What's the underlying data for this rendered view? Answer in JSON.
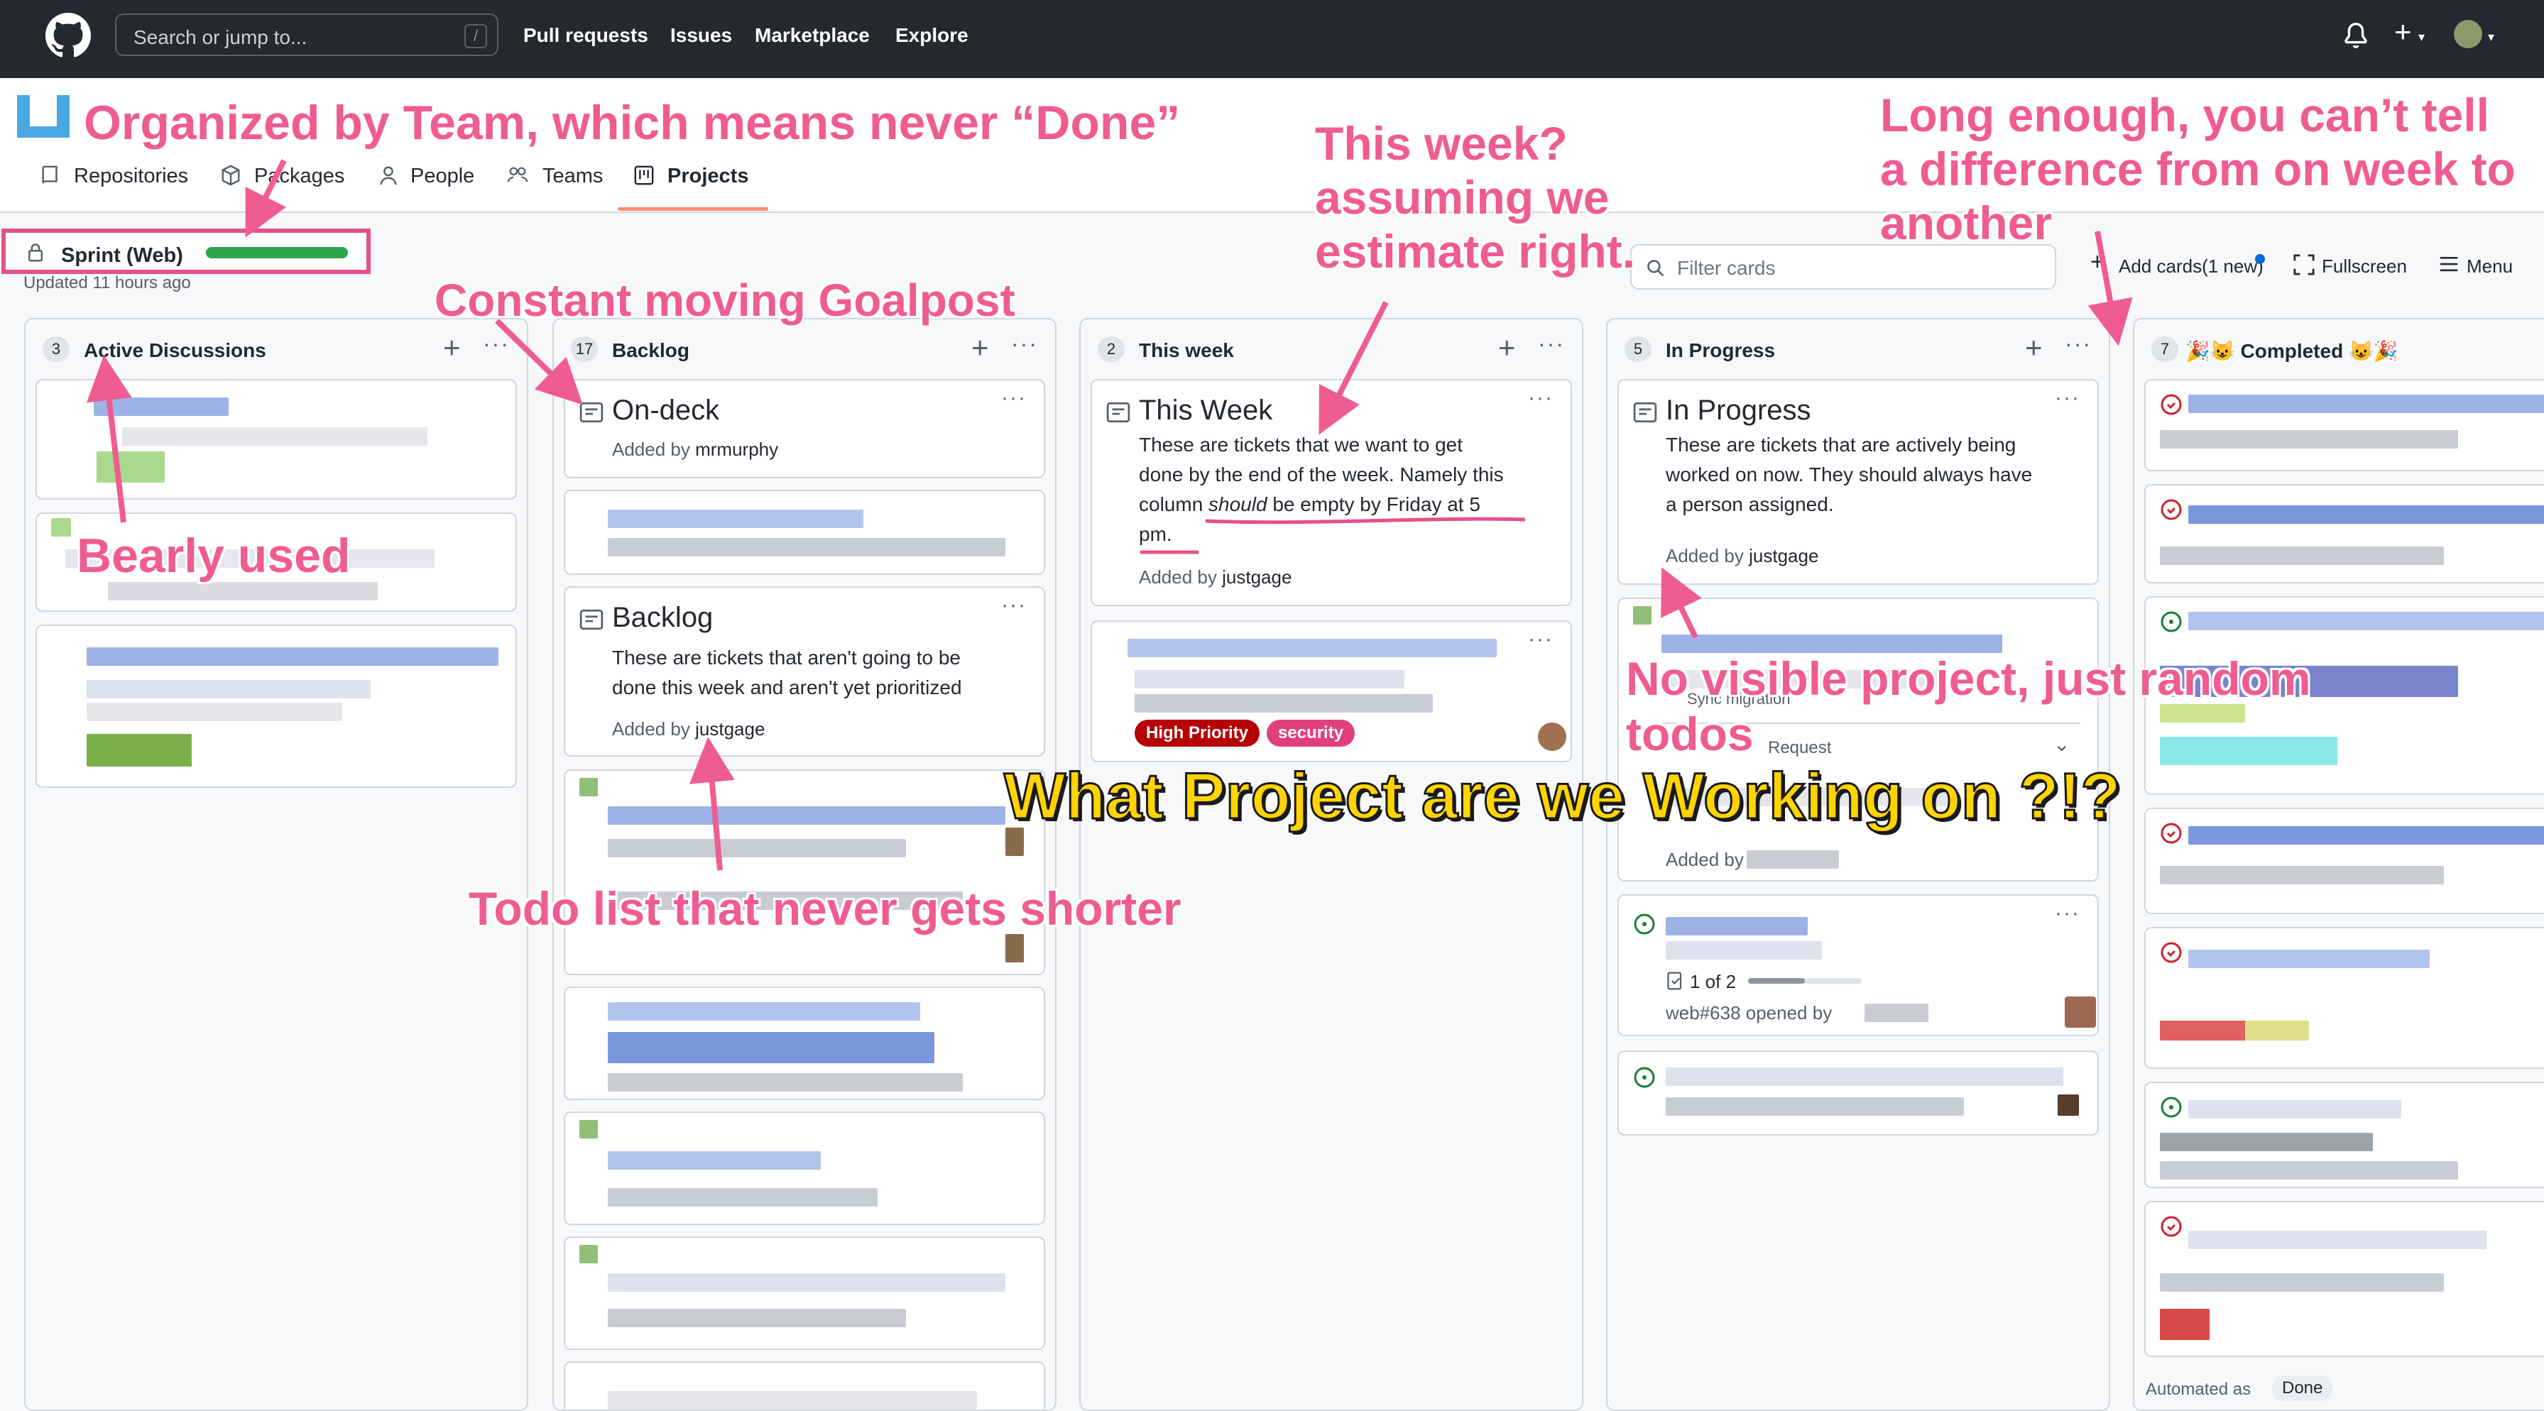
{
  "header": {
    "search_placeholder": "Search or jump to...",
    "search_key": "/",
    "nav": [
      "Pull requests",
      "Issues",
      "Marketplace",
      "Explore"
    ]
  },
  "org_tabs": [
    "Repositories",
    "Packages",
    "People",
    "Teams",
    "Projects"
  ],
  "project": {
    "name": "Sprint (Web)",
    "updated": "Updated 11 hours ago",
    "progress_percent": 100
  },
  "toolbar": {
    "filter_placeholder": "Filter cards",
    "add_cards": "Add cards(1 new)",
    "fullscreen": "Fullscreen",
    "menu": "Menu"
  },
  "columns": [
    {
      "count": "3",
      "title": "Active Discussions"
    },
    {
      "count": "17",
      "title": "Backlog"
    },
    {
      "count": "2",
      "title": "This week"
    },
    {
      "count": "5",
      "title": "In Progress"
    },
    {
      "count": "7",
      "title": "Completed",
      "emoji": "🎉😺 Completed 😺🎉"
    }
  ],
  "cards": {
    "ondeck": {
      "title": "On-deck",
      "added": "Added by",
      "user": "mrmurphy"
    },
    "backlog": {
      "title": "Backlog",
      "body": [
        "These are tickets that aren't going to be",
        "done this week and aren't yet prioritized"
      ],
      "added": "Added by",
      "user": "justgage"
    },
    "thisweek": {
      "title": "This Week",
      "body1": "These are tickets that we want to get",
      "body2": "done by the end of the week. Namely this",
      "body3a": "column ",
      "body3b": "should",
      "body3c": " be empty by Friday at 5",
      "body4": "pm.",
      "added": "Added by",
      "user": "justgage"
    },
    "labels": {
      "high": "High Priority",
      "security": "security"
    },
    "inprogress": {
      "title": "In Progress",
      "body": [
        "These are tickets that are actively being",
        "worked on now. They should always have",
        "a person assigned."
      ],
      "added": "Added by",
      "user": "justgage"
    },
    "sync": {
      "line1": "Sync migration",
      "line2": "Request",
      "added": "Added by"
    },
    "issue": {
      "checklist": "1 of 2",
      "ref": "web#638 opened by"
    }
  },
  "completed_footer": {
    "automated": "Automated as",
    "state": "Done"
  },
  "annotations": {
    "team": "Organized by Team, which means never “Done”",
    "goalpost": "Constant moving Goalpost",
    "bearly": "Bearly used",
    "thisweek": [
      "This week?",
      "assuming we",
      "estimate right."
    ],
    "long": [
      "Long enough, you can’t tell",
      "a difference from on week to",
      "another"
    ],
    "novisible": [
      "No visible project, just random",
      "todos"
    ],
    "todo": "Todo list that never gets shorter",
    "what": "What Project are we Working on ?!?"
  },
  "colors": {
    "accent": "#e5518a",
    "header": "#24292f",
    "progress": "#2da44e",
    "label_high": "#b60205",
    "label_security": "#e0407b"
  }
}
